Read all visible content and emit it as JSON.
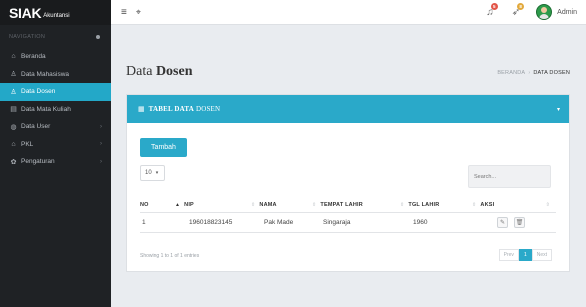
{
  "brand": {
    "name": "SIAK",
    "sub": "Akuntansi"
  },
  "sidebar": {
    "heading": "NAVIGATION",
    "items": [
      {
        "label": "Beranda",
        "icon": "home-icon",
        "glyph": "⌂",
        "arrow": ""
      },
      {
        "label": "Data Mahasiswa",
        "icon": "user-icon",
        "glyph": "♙",
        "arrow": ""
      },
      {
        "label": "Data Dosen",
        "icon": "user-icon",
        "glyph": "♙",
        "arrow": ""
      },
      {
        "label": "Data Mata Kuliah",
        "icon": "book-icon",
        "glyph": "▤",
        "arrow": ""
      },
      {
        "label": "Data User",
        "icon": "user-circle-icon",
        "glyph": "◍",
        "arrow": "›"
      },
      {
        "label": "PKL",
        "icon": "building-icon",
        "glyph": "⌂",
        "arrow": "›"
      },
      {
        "label": "Pengaturan",
        "icon": "gear-icon",
        "glyph": "✿",
        "arrow": "›"
      }
    ]
  },
  "topbar": {
    "notif_badge": "5",
    "message_badge": "8",
    "user_name": "Admin",
    "colors": {
      "notif_badge": "#e25548",
      "message_badge": "#e2a93c"
    }
  },
  "page": {
    "title_prefix": "Data ",
    "title_bold": "Dosen",
    "breadcrumb": [
      "BERANDA",
      "DATA DOSEN"
    ]
  },
  "panel": {
    "title_bold": "TABEL DATA",
    "title_rest": " DOSEN",
    "add_label": "Tambah",
    "length_value": "10",
    "search_placeholder": "Search...",
    "columns": [
      "NO",
      "NIP",
      "NAMA",
      "TEMPAT LAHIR",
      "TGL LAHIR",
      "AKSI"
    ],
    "rows": [
      {
        "no": "1",
        "nip": "196018823145",
        "nama": "Pak Made",
        "tempat_lahir": "Singaraja",
        "tgl_lahir": "1960"
      }
    ],
    "info": "Showing 1 to 1 of 1 entries",
    "pagination": {
      "prev": "Prev",
      "page": "1",
      "next": "Next"
    }
  },
  "colors": {
    "accent": "#2aa9c9",
    "sidebar": "#1f2225",
    "background": "#e9ecf0"
  }
}
